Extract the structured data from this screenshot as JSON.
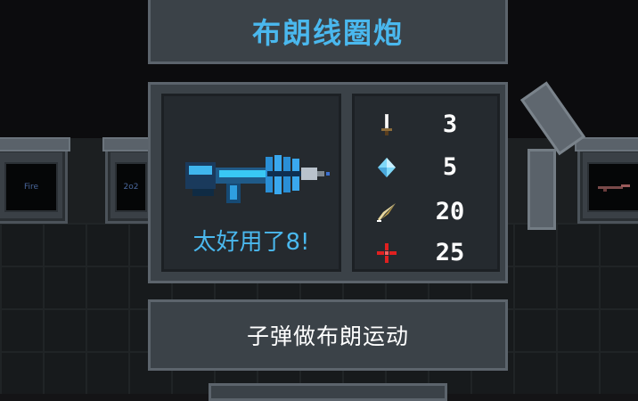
{
  "weapon": {
    "name": "布朗线圈炮",
    "quote": "太好用了8!",
    "description": "子弹做布朗运动",
    "icon": "coil-gun-icon",
    "accent_color": "#4ab8ee"
  },
  "stats": [
    {
      "name": "damage",
      "icon": "sword-icon",
      "value": "3"
    },
    {
      "name": "energy",
      "icon": "crystal-icon",
      "value": "5"
    },
    {
      "name": "critical",
      "icon": "feather-icon",
      "value": "20"
    },
    {
      "name": "accuracy",
      "icon": "crosshair-icon",
      "value": "25"
    }
  ],
  "background": {
    "shelf_labels": [
      "Fire",
      "2o2"
    ]
  }
}
